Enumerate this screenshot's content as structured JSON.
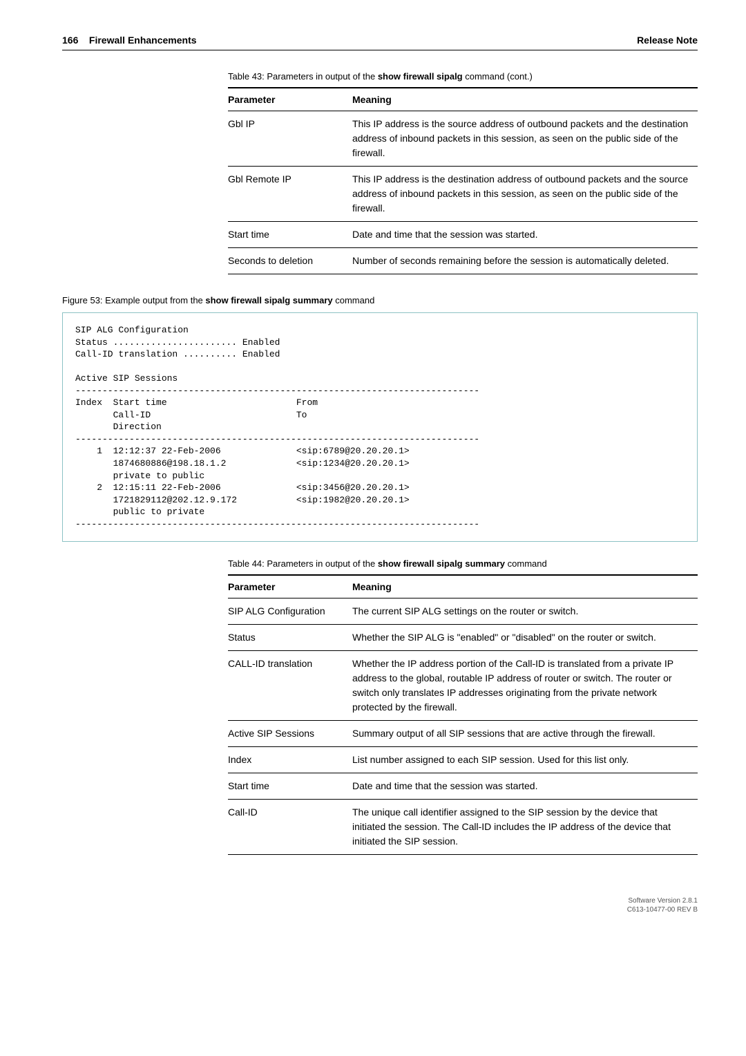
{
  "header": {
    "page_num": "166",
    "section": "Firewall Enhancements",
    "doc_type": "Release Note"
  },
  "table43": {
    "caption_prefix": "Table 43: Parameters in output of the ",
    "caption_bold": "show firewall sipalg",
    "caption_suffix": " command (cont.)",
    "col1": "Parameter",
    "col2": "Meaning",
    "rows": [
      {
        "p": "Gbl IP",
        "m": "This IP address is the source address of outbound packets and the destination address of inbound packets in this session, as seen on the public side of the firewall."
      },
      {
        "p": "Gbl Remote IP",
        "m": "This IP address is the destination address of outbound packets and the source address of inbound packets in this session, as seen on the public side of the firewall."
      },
      {
        "p": "Start time",
        "m": "Date and time that the session was started."
      },
      {
        "p": "Seconds to deletion",
        "m": "Number of seconds remaining before the session is automatically deleted."
      }
    ]
  },
  "figure53": {
    "caption_prefix": "Figure 53: Example output from the ",
    "caption_bold": "show firewall sipalg summary",
    "caption_suffix": " command",
    "code": "SIP ALG Configuration\nStatus ....................... Enabled\nCall-ID translation .......... Enabled\n\nActive SIP Sessions\n---------------------------------------------------------------------------\nIndex  Start time                        From\n       Call-ID                           To\n       Direction\n---------------------------------------------------------------------------\n    1  12:12:37 22-Feb-2006              <sip:6789@20.20.20.1>\n       1874680886@198.18.1.2             <sip:1234@20.20.20.1>\n       private to public\n    2  12:15:11 22-Feb-2006              <sip:3456@20.20.20.1>\n       1721829112@202.12.9.172           <sip:1982@20.20.20.1>\n       public to private\n---------------------------------------------------------------------------"
  },
  "table44": {
    "caption_prefix": "Table 44: Parameters in output of the ",
    "caption_bold": "show firewall sipalg summary",
    "caption_suffix": " command",
    "col1": "Parameter",
    "col2": "Meaning",
    "rows": [
      {
        "p": "SIP ALG Configuration",
        "m": "The current SIP ALG settings on the router or switch."
      },
      {
        "p": "Status",
        "m": "Whether the SIP ALG is \"enabled\" or \"disabled\" on the router or switch."
      },
      {
        "p": "CALL-ID translation",
        "m": "Whether the IP address portion of the Call-ID is translated from a private IP address to the global, routable IP address of router or switch. The router or switch only translates IP addresses originating from the private network protected by the firewall."
      },
      {
        "p": "Active SIP Sessions",
        "m": "Summary output of all SIP sessions that are active through the firewall."
      },
      {
        "p": "Index",
        "m": "List number assigned to each SIP session. Used for this list only."
      },
      {
        "p": "Start time",
        "m": "Date and time that the session was started."
      },
      {
        "p": "Call-ID",
        "m": "The unique call identifier assigned to the SIP session by the device that initiated the session. The Call-ID includes the IP address of the device that initiated the SIP session."
      }
    ]
  },
  "footer": {
    "line1": "Software Version 2.8.1",
    "line2": "C613-10477-00 REV B"
  }
}
